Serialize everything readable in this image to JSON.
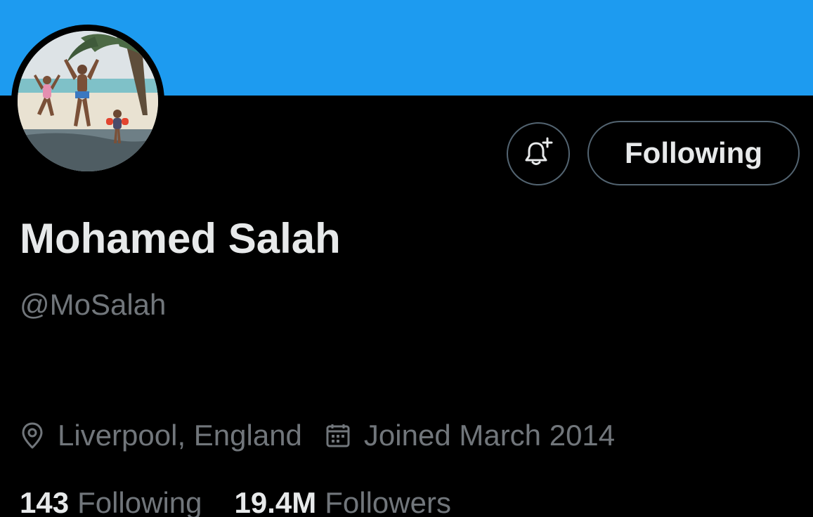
{
  "profile": {
    "display_name": "Mohamed Salah",
    "handle": "@MoSalah",
    "location": "Liverpool, England",
    "joined": "Joined March 2014",
    "avatar_description_icon": "profile-photo"
  },
  "actions": {
    "notify_icon": "bell-plus-icon",
    "follow_label": "Following"
  },
  "stats": {
    "following_count": "143",
    "following_label": "Following",
    "followers_count": "19.4M",
    "followers_label": "Followers"
  },
  "colors": {
    "banner": "#1d9bf0",
    "background": "#000000",
    "primary_text": "#e7e9ea",
    "secondary_text": "#71767b",
    "border": "#536471"
  },
  "icons": {
    "location": "map-pin-icon",
    "calendar": "calendar-icon"
  }
}
